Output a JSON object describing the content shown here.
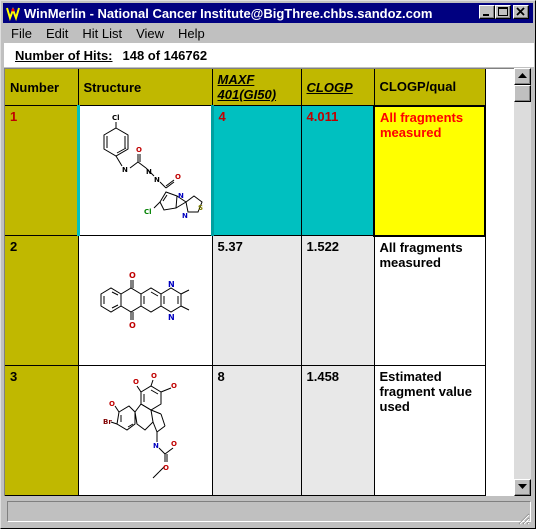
{
  "window": {
    "title": "WinMerlin - National Cancer Institute@BigThree.chbs.sandoz.com",
    "icon": "winmerlin-app-icon"
  },
  "menu": [
    "File",
    "Edit",
    "Hit List",
    "View",
    "Help"
  ],
  "hits": {
    "label": "Number of Hits:",
    "value": "148 of  146762"
  },
  "table": {
    "headers": [
      "Number",
      "Structure",
      "MAXF 401(GI50)",
      "CLOGP",
      "CLOGP/qual"
    ],
    "rows": [
      {
        "number": "1",
        "maxf": "4",
        "clogp": "4.011",
        "qual": "All fragments measured",
        "selected": true
      },
      {
        "number": "2",
        "maxf": "5.37",
        "clogp": "1.522",
        "qual": "All fragments measured",
        "selected": false
      },
      {
        "number": "3",
        "maxf": "8",
        "clogp": "1.458",
        "qual": "Estimated fragment value used",
        "selected": false
      }
    ],
    "structure_labels": {
      "r1": [
        "Cl",
        "N",
        "N",
        "O",
        "N",
        "O",
        "Cl",
        "N",
        "S",
        "N"
      ],
      "r2": [
        "O",
        "N",
        "N",
        "O"
      ],
      "r3": [
        "O",
        "O",
        "O",
        "Br",
        "O",
        "N",
        "O",
        "O"
      ]
    }
  },
  "colors": {
    "titlebar": "#000080",
    "header_bg": "#c0b800",
    "selected_teal": "#00c0c0",
    "selected_yellow": "#ffff00",
    "selected_text": "#c00000"
  }
}
